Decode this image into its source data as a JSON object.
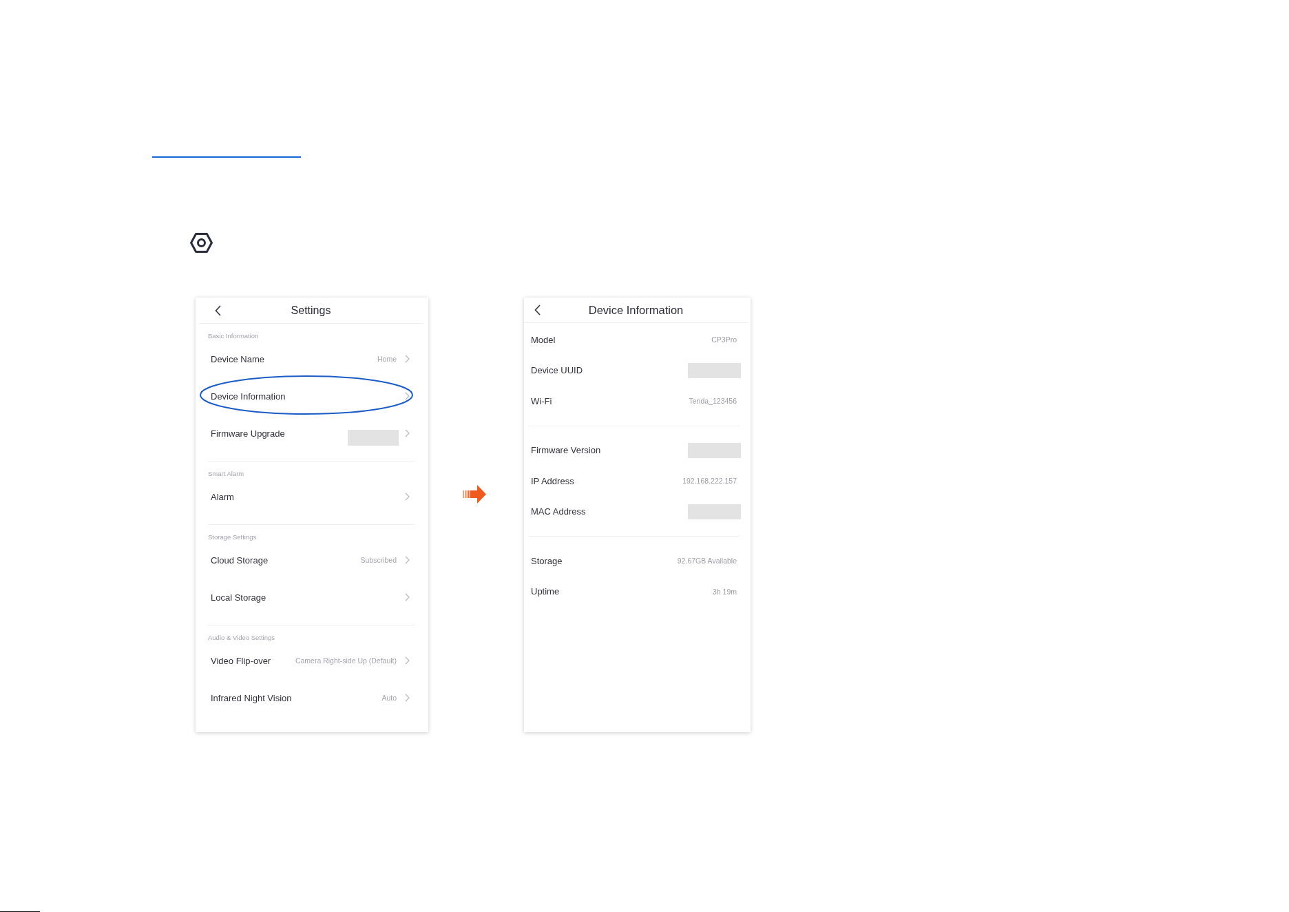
{
  "settings_screen": {
    "title": "Settings",
    "sections": [
      {
        "label": "Basic Information",
        "items": [
          {
            "label": "Device Name",
            "value": "Home",
            "redacted": false,
            "circled": false
          },
          {
            "label": "Device Information",
            "redacted": false,
            "circled": true
          },
          {
            "label": "Firmware Upgrade",
            "redacted": true,
            "circled": false
          }
        ]
      },
      {
        "label": "Smart Alarm",
        "items": [
          {
            "label": "Alarm",
            "redacted": false,
            "circled": false
          }
        ]
      },
      {
        "label": "Storage Settings",
        "items": [
          {
            "label": "Cloud Storage",
            "value": "Subscribed",
            "redacted": false,
            "circled": false
          },
          {
            "label": "Local Storage",
            "redacted": false,
            "circled": false
          }
        ]
      },
      {
        "label": "Audio & Video Settings",
        "items": [
          {
            "label": "Video Flip-over",
            "value": "Camera Right-side Up (Default)",
            "redacted": false,
            "circled": false
          },
          {
            "label": "Infrared Night Vision",
            "value": "Auto",
            "redacted": false,
            "circled": false
          }
        ]
      }
    ]
  },
  "device_info_screen": {
    "title": "Device Information",
    "groups": [
      {
        "items": [
          {
            "label": "Model",
            "value": "CP3Pro",
            "redacted": false
          },
          {
            "label": "Device UUID",
            "redacted": true
          },
          {
            "label": "Wi-Fi",
            "value": "Tenda_123456",
            "redacted": false
          }
        ]
      },
      {
        "items": [
          {
            "label": "Firmware Version",
            "redacted": true
          },
          {
            "label": "IP Address",
            "value": "192.168.222.157",
            "redacted": false
          },
          {
            "label": "MAC Address",
            "redacted": true
          }
        ]
      },
      {
        "items": [
          {
            "label": "Storage",
            "value": "92.67GB Available",
            "redacted": false
          },
          {
            "label": "Uptime",
            "value": "3h 19m",
            "redacted": false
          }
        ]
      }
    ]
  }
}
